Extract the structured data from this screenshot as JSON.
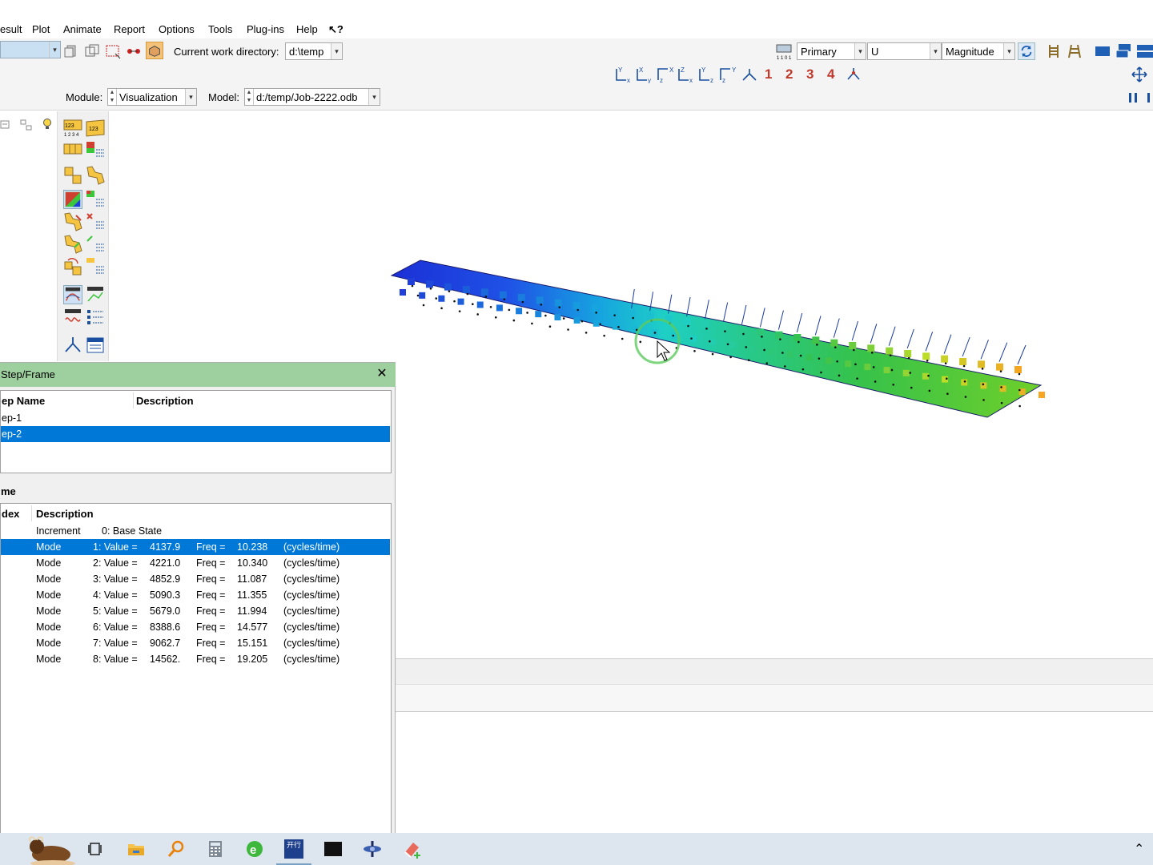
{
  "menu": {
    "items": [
      "esult",
      "Plot",
      "Animate",
      "Report",
      "Options",
      "Tools",
      "Plug-ins",
      "Help"
    ],
    "help_query_glyph": "↖?"
  },
  "toolbar1": {
    "cwd_label": "Current work directory:",
    "cwd_value": "d:\\temp",
    "primary_label": "Primary",
    "variable_value": "U",
    "invariant_value": "Magnitude",
    "step_icon_caption": "1 1 0 1 0"
  },
  "toolbar2": {
    "view_numbers": [
      "1",
      "2",
      "3",
      "4"
    ],
    "axis_icons": [
      "xy-view-icon",
      "yx-view-icon",
      "zx-view-icon",
      "xz-view-icon",
      "yz-view-icon",
      "zy-view-icon",
      "iso-view-icon"
    ]
  },
  "modbar": {
    "module_label": "Module:",
    "module_value": "Visualization",
    "model_label": "Model:",
    "model_value": "d:/temp/Job-2222.odb"
  },
  "dialog": {
    "title": "Step/Frame",
    "close_glyph": "✕",
    "step_headers": {
      "name": "ep Name",
      "description": "Description"
    },
    "steps": [
      {
        "name": "ep-1",
        "selected": false
      },
      {
        "name": "ep-2",
        "selected": true
      }
    ],
    "frame_section_label": "me",
    "frame_headers": {
      "index": "dex",
      "description": "Description"
    },
    "frames": [
      {
        "type": "Increment",
        "num": "0: Base State",
        "value": "",
        "freq_label": "",
        "freq": "",
        "units": "",
        "selected": false
      },
      {
        "type": "Mode",
        "num": "1: Value =",
        "value": "4137.9",
        "freq_label": "Freq =",
        "freq": "10.238",
        "units": "(cycles/time)",
        "selected": true
      },
      {
        "type": "Mode",
        "num": "2: Value =",
        "value": "4221.0",
        "freq_label": "Freq =",
        "freq": "10.340",
        "units": "(cycles/time)",
        "selected": false
      },
      {
        "type": "Mode",
        "num": "3: Value =",
        "value": "4852.9",
        "freq_label": "Freq =",
        "freq": "11.087",
        "units": "(cycles/time)",
        "selected": false
      },
      {
        "type": "Mode",
        "num": "4: Value =",
        "value": "5090.3",
        "freq_label": "Freq =",
        "freq": "11.355",
        "units": "(cycles/time)",
        "selected": false
      },
      {
        "type": "Mode",
        "num": "5: Value =",
        "value": "5679.0",
        "freq_label": "Freq =",
        "freq": "11.994",
        "units": "(cycles/time)",
        "selected": false
      },
      {
        "type": "Mode",
        "num": "6: Value =",
        "value": "8388.6",
        "freq_label": "Freq =",
        "freq": "14.577",
        "units": "(cycles/time)",
        "selected": false
      },
      {
        "type": "Mode",
        "num": "7: Value =",
        "value": "9062.7",
        "freq_label": "Freq =",
        "freq": "15.151",
        "units": "(cycles/time)",
        "selected": false
      },
      {
        "type": "Mode",
        "num": "8: Value =",
        "value": "14562.",
        "freq_label": "Freq =",
        "freq": "19.205",
        "units": "(cycles/time)",
        "selected": false
      }
    ]
  },
  "colors": {
    "dialog_title_bg": "#9ecf9e",
    "selection": "#0078d7",
    "view_number": "#c0392b",
    "contour_blue": "#1f3fd8",
    "contour_green": "#3cc63c",
    "contour_orange": "#f5a623"
  },
  "taskbar": {
    "icons": [
      "mascot-icon",
      "task-view-icon",
      "file-explorer-icon",
      "search-icon",
      "calculator-icon",
      "edge-icon",
      "bank-app-icon",
      "terminal-icon",
      "abaqus-icon",
      "eraser-app-icon"
    ],
    "bank_app_text": "开行",
    "tray_chevron": "⌃"
  }
}
